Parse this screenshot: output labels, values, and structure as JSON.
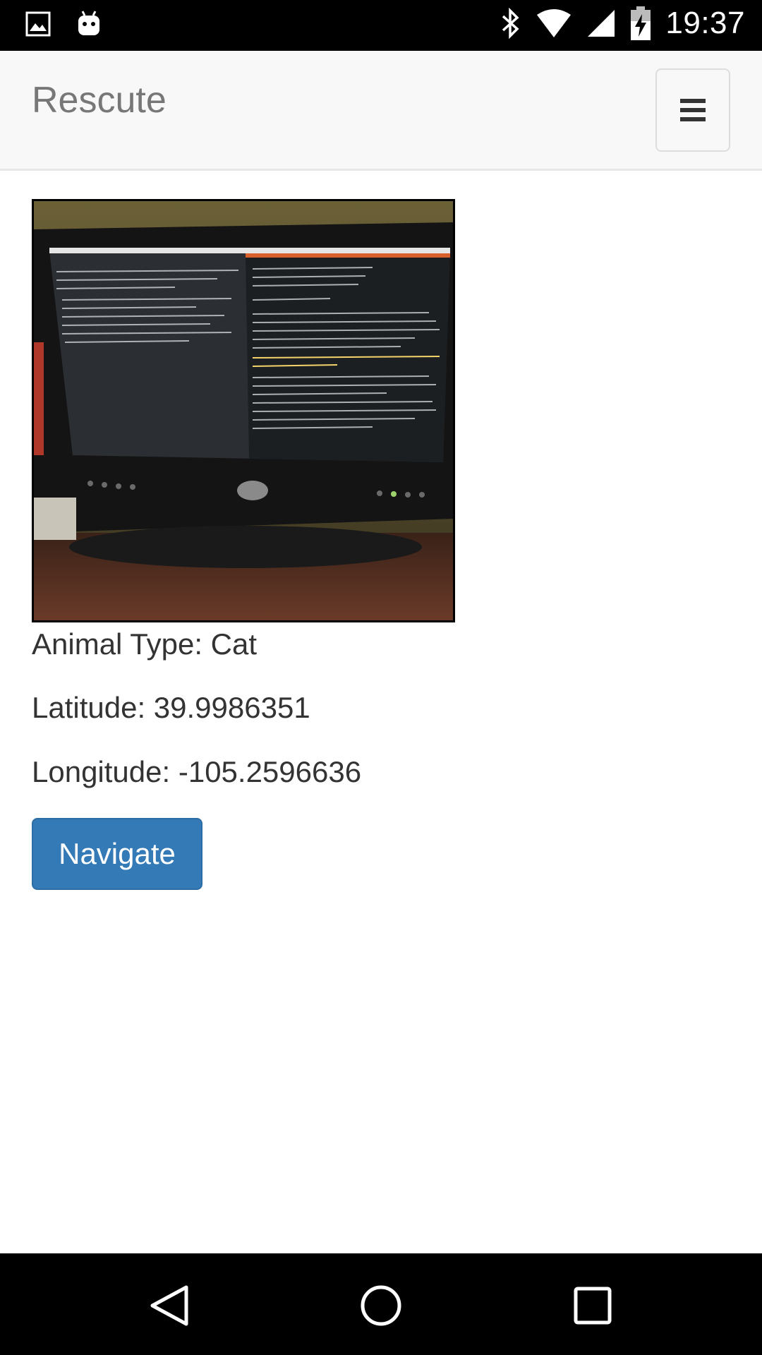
{
  "status_bar": {
    "time": "19:37",
    "icons": [
      "image-icon",
      "android-icon",
      "bluetooth-icon",
      "wifi-icon",
      "signal-icon",
      "battery-charging-icon"
    ]
  },
  "navbar": {
    "brand": "Rescute",
    "menu_icon": "hamburger-menu-icon"
  },
  "animal": {
    "photo_alt": "Photo of a computer monitor showing terminal output",
    "type_line": "Animal Type: Cat",
    "latitude_line": "Latitude: 39.9986351",
    "longitude_line": "Longitude: -105.2596636"
  },
  "actions": {
    "navigate_label": "Navigate"
  },
  "system_nav": {
    "icons": [
      "back-icon",
      "home-icon",
      "recents-icon"
    ]
  },
  "colors": {
    "status_bar": "#000000",
    "navbar_bg": "#f8f8f8",
    "brand_text": "#777777",
    "primary_button": "#337ab7",
    "body_text": "#333333"
  }
}
